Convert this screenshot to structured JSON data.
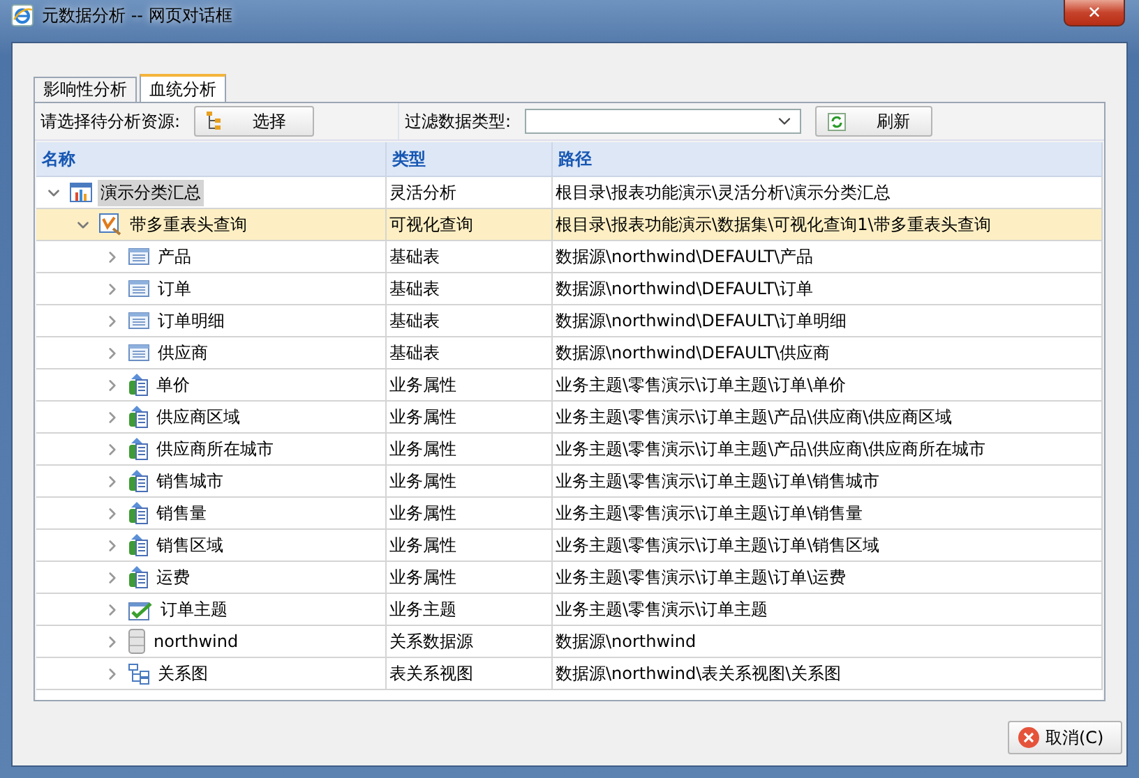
{
  "window": {
    "title": "元数据分析 -- 网页对话框",
    "close_label": "✕"
  },
  "tabs": [
    {
      "label": "影响性分析",
      "selected": false
    },
    {
      "label": "血统分析",
      "selected": true
    }
  ],
  "toolbar": {
    "resource_label": "请选择待分析资源:",
    "select_button": "选择",
    "filter_label": "过滤数据类型:",
    "refresh_button": "刷新"
  },
  "table": {
    "columns": [
      "名称",
      "类型",
      "路径"
    ],
    "rows": [
      {
        "name": "演示分类汇总",
        "type": "灵活分析",
        "path": "根目录\\报表功能演示\\灵活分析\\演示分类汇总",
        "kind": "analysis",
        "expanded": true,
        "selected": false,
        "highlighted": true,
        "children": [
          {
            "name": "带多重表头查询",
            "type": "可视化查询",
            "path": "根目录\\报表功能演示\\数据集\\可视化查询1\\带多重表头查询",
            "kind": "query",
            "expanded": true,
            "selected": true,
            "highlighted": false,
            "children": [
              {
                "name": "产品",
                "type": "基础表",
                "path": "数据源\\northwind\\DEFAULT\\产品",
                "kind": "table",
                "expanded": false,
                "selected": false,
                "highlighted": false
              },
              {
                "name": "订单",
                "type": "基础表",
                "path": "数据源\\northwind\\DEFAULT\\订单",
                "kind": "table",
                "expanded": false,
                "selected": false,
                "highlighted": false
              },
              {
                "name": "订单明细",
                "type": "基础表",
                "path": "数据源\\northwind\\DEFAULT\\订单明细",
                "kind": "table",
                "expanded": false,
                "selected": false,
                "highlighted": false
              },
              {
                "name": "供应商",
                "type": "基础表",
                "path": "数据源\\northwind\\DEFAULT\\供应商",
                "kind": "table",
                "expanded": false,
                "selected": false,
                "highlighted": false
              },
              {
                "name": "单价",
                "type": "业务属性",
                "path": "业务主题\\零售演示\\订单主题\\订单\\单价",
                "kind": "attribute",
                "expanded": false,
                "selected": false,
                "highlighted": false
              },
              {
                "name": "供应商区域",
                "type": "业务属性",
                "path": "业务主题\\零售演示\\订单主题\\产品\\供应商\\供应商区域",
                "kind": "attribute",
                "expanded": false,
                "selected": false,
                "highlighted": false
              },
              {
                "name": "供应商所在城市",
                "type": "业务属性",
                "path": "业务主题\\零售演示\\订单主题\\产品\\供应商\\供应商所在城市",
                "kind": "attribute",
                "expanded": false,
                "selected": false,
                "highlighted": false
              },
              {
                "name": "销售城市",
                "type": "业务属性",
                "path": "业务主题\\零售演示\\订单主题\\订单\\销售城市",
                "kind": "attribute",
                "expanded": false,
                "selected": false,
                "highlighted": false
              },
              {
                "name": "销售量",
                "type": "业务属性",
                "path": "业务主题\\零售演示\\订单主题\\订单\\销售量",
                "kind": "attribute",
                "expanded": false,
                "selected": false,
                "highlighted": false
              },
              {
                "name": "销售区域",
                "type": "业务属性",
                "path": "业务主题\\零售演示\\订单主题\\订单\\销售区域",
                "kind": "attribute",
                "expanded": false,
                "selected": false,
                "highlighted": false
              },
              {
                "name": "运费",
                "type": "业务属性",
                "path": "业务主题\\零售演示\\订单主题\\订单\\运费",
                "kind": "attribute",
                "expanded": false,
                "selected": false,
                "highlighted": false
              },
              {
                "name": "订单主题",
                "type": "业务主题",
                "path": "业务主题\\零售演示\\订单主题",
                "kind": "subject",
                "expanded": false,
                "selected": false,
                "highlighted": false
              },
              {
                "name": "northwind",
                "type": "关系数据源",
                "path": "数据源\\northwind",
                "kind": "datasource",
                "expanded": false,
                "selected": false,
                "highlighted": false
              },
              {
                "name": "关系图",
                "type": "表关系视图",
                "path": "数据源\\northwind\\表关系视图\\关系图",
                "kind": "diagram",
                "expanded": false,
                "selected": false,
                "highlighted": false
              }
            ]
          }
        ]
      }
    ]
  },
  "footer": {
    "cancel_button": "取消(C)"
  }
}
